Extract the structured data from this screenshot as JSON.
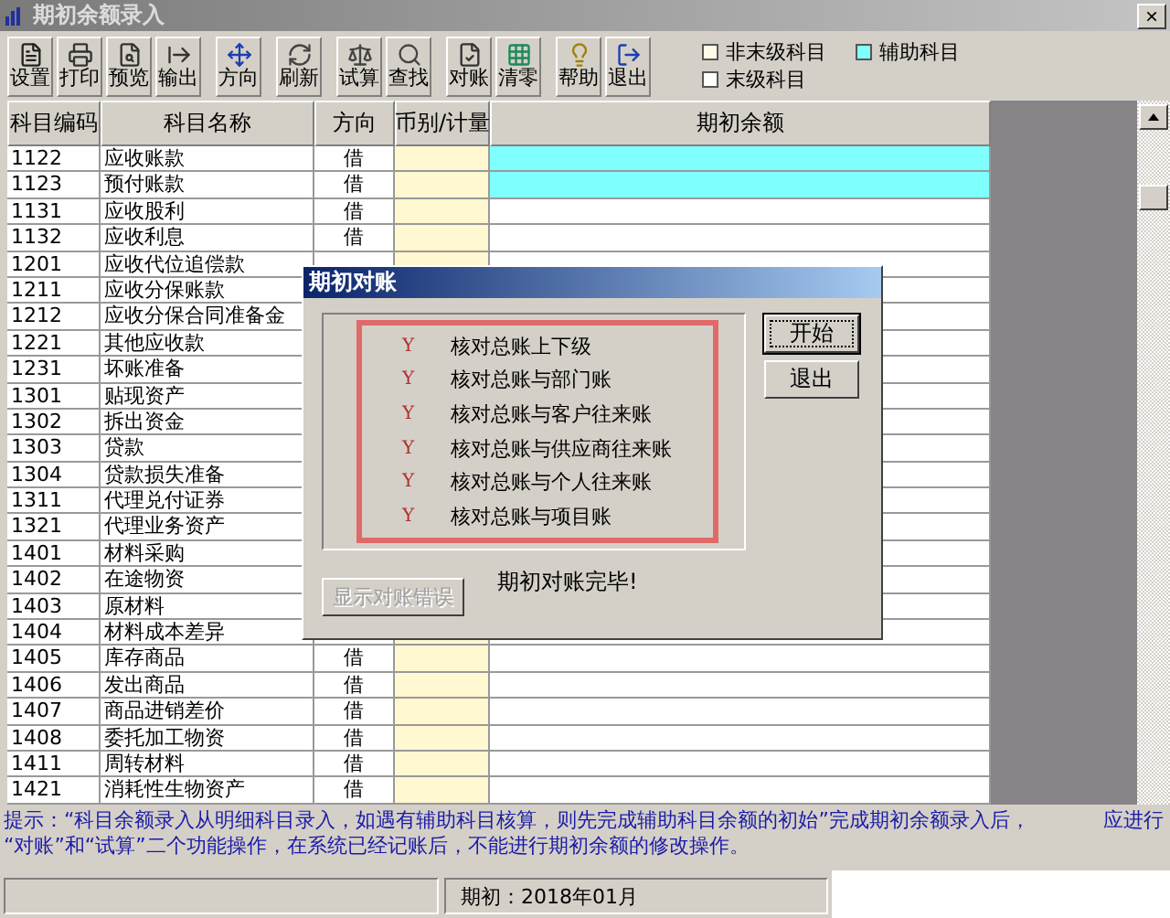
{
  "window": {
    "title": "期初余额录入",
    "close": "×"
  },
  "toolbar": {
    "groups": [
      [
        {
          "label": "设置"
        },
        {
          "label": "打印"
        },
        {
          "label": "预览"
        },
        {
          "label": "输出"
        }
      ],
      [
        {
          "label": "方向"
        }
      ],
      [
        {
          "label": "刷新"
        }
      ],
      [
        {
          "label": "试算"
        },
        {
          "label": "查找"
        }
      ],
      [
        {
          "label": "对账"
        },
        {
          "label": "清零"
        }
      ],
      [
        {
          "label": "帮助"
        },
        {
          "label": "退出"
        }
      ]
    ]
  },
  "legend": [
    {
      "label": "非末级科目",
      "color": "#fffbe8"
    },
    {
      "label": "辅助科目",
      "color": "#80ffff"
    },
    {
      "label": "末级科目",
      "color": "#ffffff"
    }
  ],
  "table": {
    "columns": [
      "科目编码",
      "科目名称",
      "方向",
      "币别/计量",
      "期初余额"
    ],
    "rows": [
      {
        "code": "1122",
        "name": "应收账款",
        "direction": "借",
        "auxiliary": true
      },
      {
        "code": "1123",
        "name": "预付账款",
        "direction": "借",
        "auxiliary": true
      },
      {
        "code": "1131",
        "name": "应收股利",
        "direction": "借",
        "auxiliary": false
      },
      {
        "code": "1132",
        "name": "应收利息",
        "direction": "借",
        "auxiliary": false
      },
      {
        "code": "1201",
        "name": "应收代位追偿款",
        "auxiliary": false
      },
      {
        "code": "1211",
        "name": "应收分保账款",
        "auxiliary": false
      },
      {
        "code": "1212",
        "name": "应收分保合同准备金",
        "auxiliary": false
      },
      {
        "code": "1221",
        "name": "其他应收款",
        "auxiliary": false
      },
      {
        "code": "1231",
        "name": "坏账准备",
        "auxiliary": false
      },
      {
        "code": "1301",
        "name": "贴现资产",
        "auxiliary": false
      },
      {
        "code": "1302",
        "name": "拆出资金",
        "auxiliary": false
      },
      {
        "code": "1303",
        "name": "贷款",
        "auxiliary": false
      },
      {
        "code": "1304",
        "name": "贷款损失准备",
        "auxiliary": false
      },
      {
        "code": "1311",
        "name": "代理兑付证券",
        "auxiliary": false
      },
      {
        "code": "1321",
        "name": "代理业务资产",
        "auxiliary": false
      },
      {
        "code": "1401",
        "name": "材料采购",
        "auxiliary": false
      },
      {
        "code": "1402",
        "name": "在途物资",
        "auxiliary": false
      },
      {
        "code": "1403",
        "name": "原材料",
        "auxiliary": false
      },
      {
        "code": "1404",
        "name": "材料成本差异",
        "auxiliary": false
      },
      {
        "code": "1405",
        "name": "库存商品",
        "direction": "借",
        "auxiliary": false
      },
      {
        "code": "1406",
        "name": "发出商品",
        "direction": "借",
        "auxiliary": false
      },
      {
        "code": "1407",
        "name": "商品进销差价",
        "direction": "借",
        "auxiliary": false
      },
      {
        "code": "1408",
        "name": "委托加工物资",
        "direction": "借",
        "auxiliary": false
      },
      {
        "code": "1411",
        "name": "周转材料",
        "direction": "借",
        "auxiliary": false
      },
      {
        "code": "1421",
        "name": "消耗性生物资产",
        "direction": "借",
        "auxiliary": false
      }
    ]
  },
  "dialog": {
    "title": "期初对账",
    "checks": [
      {
        "mark": "Y",
        "label": "核对总账上下级"
      },
      {
        "mark": "Y",
        "label": "核对总账与部门账"
      },
      {
        "mark": "Y",
        "label": "核对总账与客户往来账"
      },
      {
        "mark": "Y",
        "label": "核对总账与供应商往来账"
      },
      {
        "mark": "Y",
        "label": "核对总账与个人往来账"
      },
      {
        "mark": "Y",
        "label": "核对总账与项目账"
      }
    ],
    "buttons": [
      {
        "label": "开始",
        "focused": true
      },
      {
        "label": "退出",
        "focused": false
      }
    ],
    "message": "期初对账完毕!",
    "error_button": {
      "label": "显示对账错误",
      "disabled": true
    }
  },
  "hint": {
    "line_1": "提示：“科目余额录入从明细科目录入，如遇有辅助科目核算，则先完成辅助科目余额的初始”完成期初余额录入后，",
    "line_1_end": "应进行",
    "line_2": "“对账”和“试算”二个功能操作，在系统已经记账后，不能进行期初余额的修改操作。"
  },
  "status_bar": {
    "period": "期初：2018年01月"
  }
}
